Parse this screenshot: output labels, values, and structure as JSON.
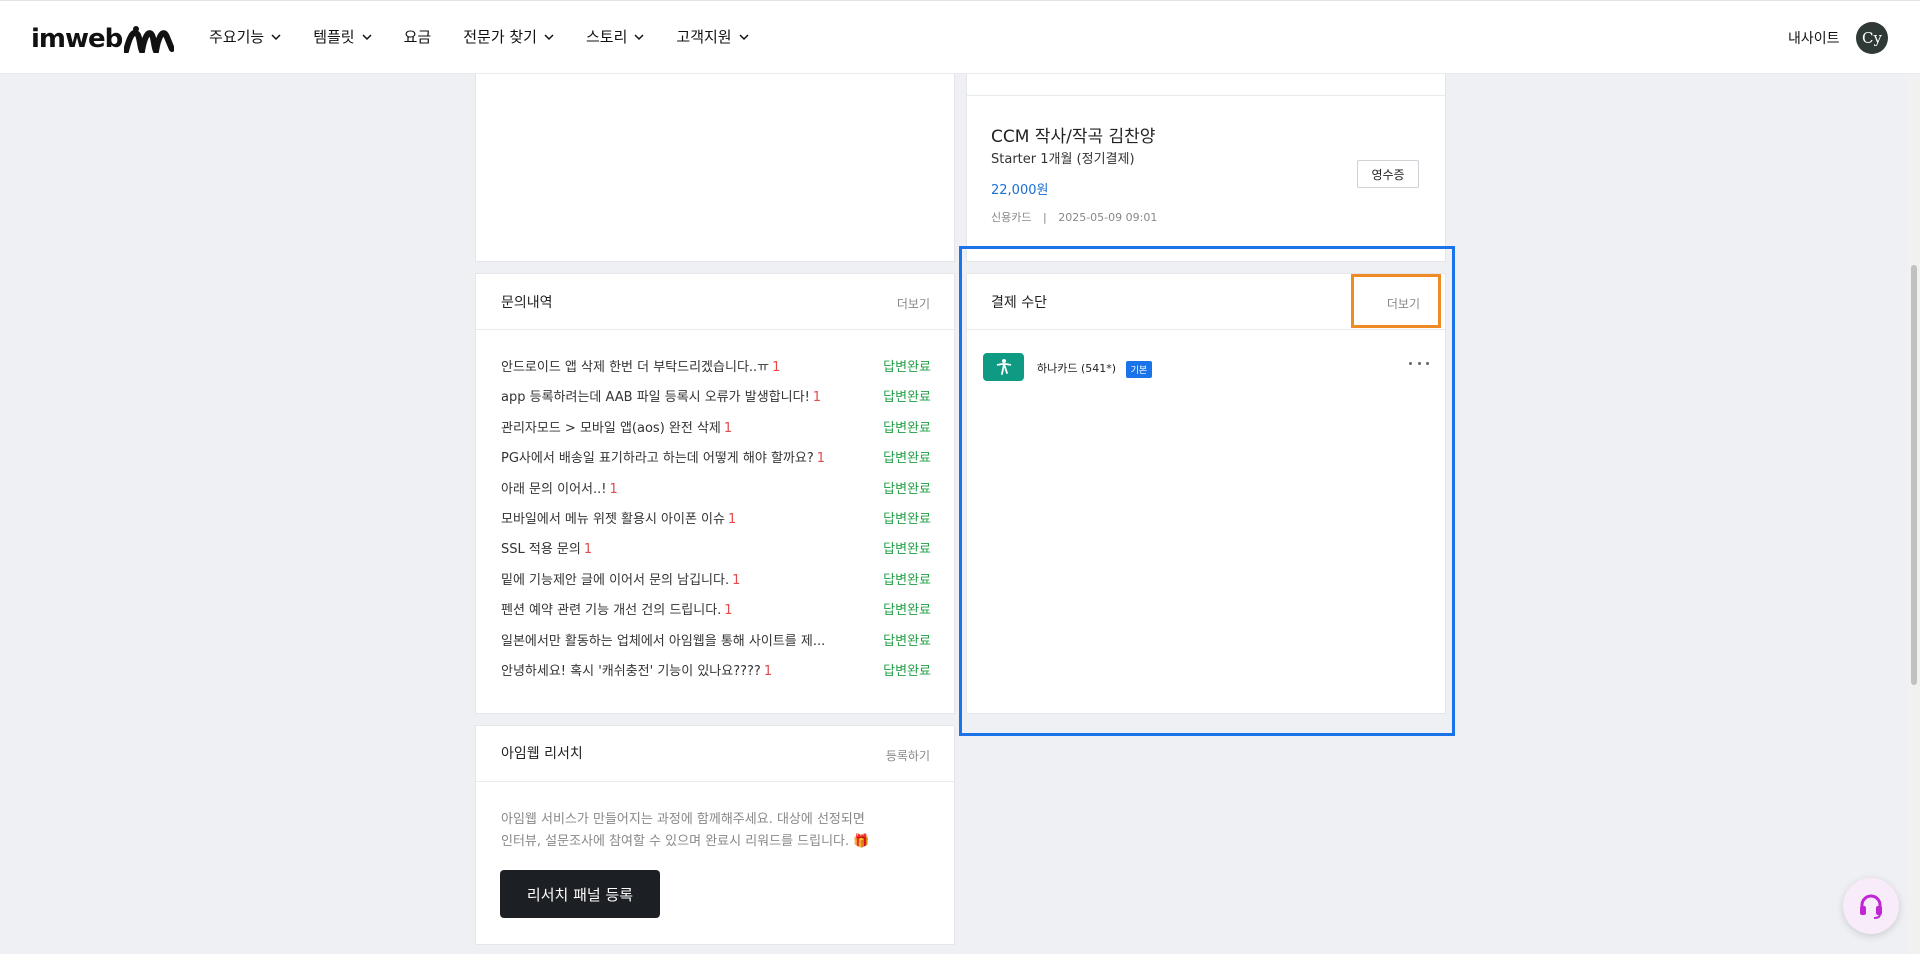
{
  "header": {
    "logo_text": "imweb",
    "nav": [
      {
        "label": "주요기능",
        "has_dropdown": true
      },
      {
        "label": "템플릿",
        "has_dropdown": true
      },
      {
        "label": "요금",
        "has_dropdown": false
      },
      {
        "label": "전문가 찾기",
        "has_dropdown": true
      },
      {
        "label": "스토리",
        "has_dropdown": true
      },
      {
        "label": "고객지원",
        "has_dropdown": true
      }
    ],
    "my_site": "내사이트",
    "avatar_initials": "Cy"
  },
  "subscription": {
    "site_name": "CCM 작사/작곡 김찬양",
    "plan": "Starter 1개월 (정기결제)",
    "price": "22,000원",
    "method": "신용카드",
    "separator": "|",
    "date": "2025-05-09 09:01",
    "receipt_button": "영수증"
  },
  "inquiries": {
    "title": "문의내역",
    "more": "더보기",
    "items": [
      {
        "text": "안드로이드 앱 삭제 한번 더 부탁드리겠습니다..ㅠ",
        "count": "1",
        "status": "답변완료"
      },
      {
        "text": "app 등록하려는데 AAB 파일 등록시 오류가 발생합니다!",
        "count": "1",
        "status": "답변완료"
      },
      {
        "text": "관리자모드 > 모바일 앱(aos) 완전 삭제",
        "count": "1",
        "status": "답변완료"
      },
      {
        "text": "PG사에서 배송일 표기하라고 하는데 어떻게 해야 할까요?",
        "count": "1",
        "status": "답변완료"
      },
      {
        "text": "아래 문의 이어서..!",
        "count": "1",
        "status": "답변완료"
      },
      {
        "text": "모바일에서 메뉴 위젯 활용시 아이폰 이슈",
        "count": "1",
        "status": "답변완료"
      },
      {
        "text": "SSL 적용 문의",
        "count": "1",
        "status": "답변완료"
      },
      {
        "text": "밑에 기능제안 글에 이어서 문의 남깁니다.",
        "count": "1",
        "status": "답변완료"
      },
      {
        "text": "펜션 예약 관련 기능 개선 건의 드립니다.",
        "count": "1",
        "status": "답변완료"
      },
      {
        "text": "일본에서만 활동하는 업체에서 아임웹을 통해 사이트를 제...",
        "count": "",
        "status": "답변완료"
      },
      {
        "text": "안녕하세요! 혹시 '캐쉬충전' 기능이 있나요????",
        "count": "1",
        "status": "답변완료"
      }
    ]
  },
  "payment_method": {
    "title": "결제 수단",
    "more": "더보기",
    "card_label": "하나카드 (541*)",
    "badge": "기본"
  },
  "research": {
    "title": "아임웹 리서치",
    "register_link": "등록하기",
    "description_line1": "아임웹 서비스가 만들어지는 과정에 함께해주세요. 대상에 선정되면",
    "description_line2": "인터뷰, 설문조사에 참여할 수 있으며 완료시 리워드를 드립니다. 🎁",
    "button": "리서치 패널 등록"
  },
  "colors": {
    "price_blue": "#1a6fd1",
    "status_green": "#21a045",
    "count_red": "#e34b4b",
    "highlight_blue": "#1a73e8",
    "highlight_orange": "#f08a24",
    "hana_green": "#0f9b83"
  }
}
